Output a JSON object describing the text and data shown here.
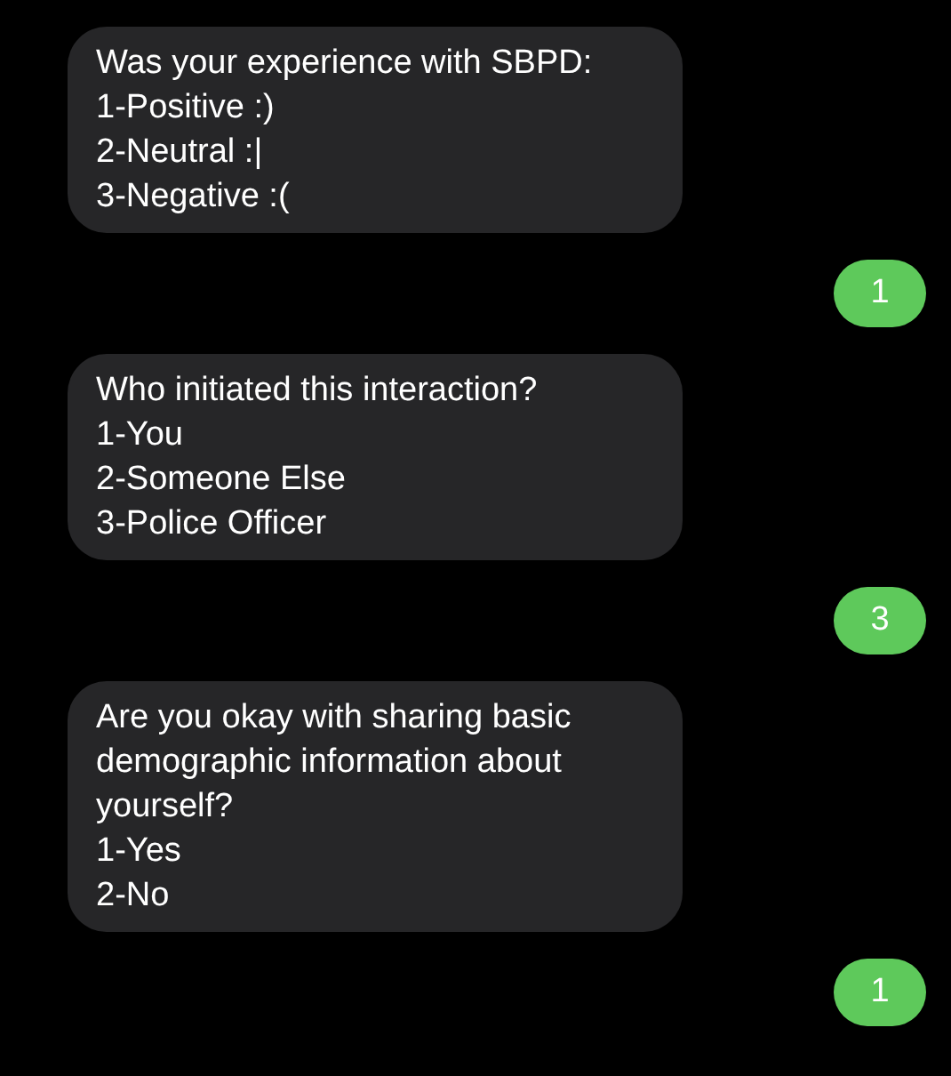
{
  "messages": [
    {
      "kind": "received",
      "lines": [
        "Was your experience with SBPD:",
        "1-Positive :)",
        "2-Neutral :|",
        "3-Negative :("
      ]
    },
    {
      "kind": "sent",
      "lines": [
        "1"
      ]
    },
    {
      "kind": "received",
      "lines": [
        "Who initiated this interaction?",
        "1-You",
        "2-Someone Else",
        "3-Police Officer"
      ]
    },
    {
      "kind": "sent",
      "lines": [
        "3"
      ]
    },
    {
      "kind": "received",
      "lines": [
        "Are you okay with sharing basic",
        "demographic information about",
        "yourself?",
        "1-Yes",
        "2-No"
      ]
    },
    {
      "kind": "sent",
      "lines": [
        "1"
      ]
    }
  ]
}
